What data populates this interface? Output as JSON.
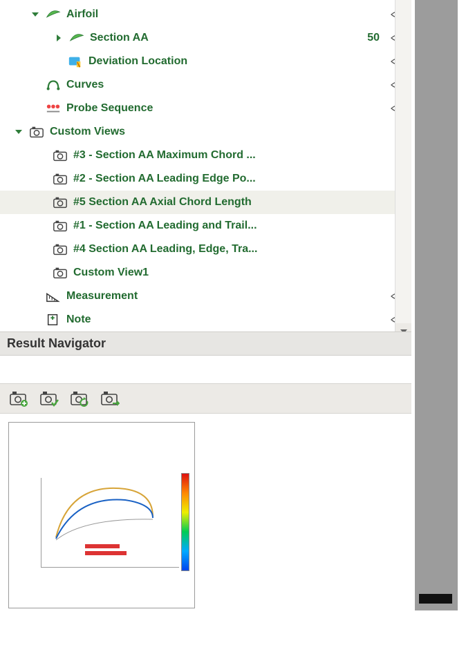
{
  "tree": {
    "airfoil": {
      "label": "Airfoil"
    },
    "section_aa": {
      "label": "Section AA",
      "value": "50"
    },
    "deviation_location": {
      "label": "Deviation Location"
    },
    "curves": {
      "label": "Curves"
    },
    "probe_sequence": {
      "label": "Probe Sequence"
    },
    "custom_views": {
      "label": "Custom Views",
      "items": [
        {
          "label": "#3 - Section AA Maximum Chord ..."
        },
        {
          "label": "#2 - Section AA Leading Edge Po..."
        },
        {
          "label": "#5 Section AA Axial Chord Length"
        },
        {
          "label": "#1 - Section AA Leading and Trail..."
        },
        {
          "label": "#4 Section AA Leading, Edge, Tra..."
        },
        {
          "label": "Custom View1"
        }
      ]
    },
    "measurement": {
      "label": "Measurement"
    },
    "note": {
      "label": "Note"
    }
  },
  "result_navigator": {
    "title": "Result Navigator"
  }
}
